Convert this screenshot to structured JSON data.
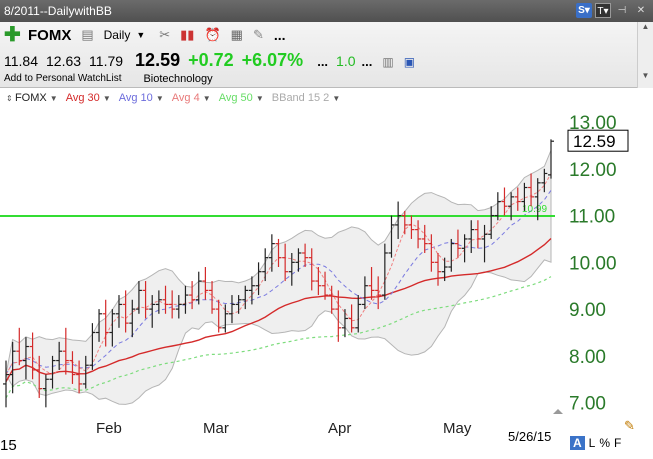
{
  "window": {
    "title": "8/2011--DailywithBB"
  },
  "toolbar": {
    "symbol": "FOMX",
    "period": "Daily",
    "more": "..."
  },
  "quote": {
    "open": "11.84",
    "high": "12.63",
    "low": "11.79",
    "last": "12.59",
    "change": "+0.72",
    "change_pct": "+6.07%",
    "ellipsis1": "...",
    "volume_ratio": "1.0",
    "ellipsis2": "...",
    "watchlist_link": "Add to Personal WatchList",
    "industry": "Biotechnology"
  },
  "studies": {
    "fomx": "FOMX",
    "avg30": "Avg 30",
    "avg10": "Avg 10",
    "avg4": "Avg 4",
    "avg50": "Avg 50",
    "bband": "BBand 15 2"
  },
  "axis": {
    "price_ticks": [
      "13.00",
      "12.00",
      "11.00",
      "10.00",
      "9.00",
      "8.00",
      "7.00"
    ],
    "months": [
      "Feb",
      "Mar",
      "Apr",
      "May"
    ],
    "current_price_box": "12.59",
    "line_label": "10.99",
    "bottom_left": "15",
    "date": "5/26/15"
  },
  "footer": {
    "a": "A",
    "l": "L",
    "pct": "%",
    "f": "F"
  },
  "colors": {
    "price_axis": "#2a7a2a",
    "change_green": "#22cc22",
    "up_bar": "#222222",
    "down_bar": "#d42a2a",
    "avg30": "#d42a2a",
    "avg10": "#7a7ae0",
    "avg4": "#f08080",
    "avg50": "#7ddc7d",
    "bband_fill": "#efefef",
    "hline": "#33dd33"
  },
  "icons": [
    "plus-icon",
    "stack-icon",
    "tools-icon",
    "bar-chart-icon",
    "alarm-icon",
    "grid-icon",
    "notes-icon",
    "database-icon",
    "save-icon"
  ],
  "chart_data": {
    "type": "line",
    "y_range": [
      6.8,
      13.3
    ],
    "hline": 10.99,
    "last": 12.59,
    "bars": [
      {
        "o": 7.4,
        "h": 7.9,
        "l": 6.9,
        "c": 7.6
      },
      {
        "o": 7.6,
        "h": 8.3,
        "l": 7.2,
        "c": 8.1
      },
      {
        "o": 8.1,
        "h": 8.6,
        "l": 7.8,
        "c": 7.9
      },
      {
        "o": 7.9,
        "h": 8.4,
        "l": 7.5,
        "c": 8.2
      },
      {
        "o": 8.2,
        "h": 8.5,
        "l": 7.5,
        "c": 7.7
      },
      {
        "o": 7.7,
        "h": 8.0,
        "l": 7.1,
        "c": 7.3
      },
      {
        "o": 7.3,
        "h": 7.6,
        "l": 6.9,
        "c": 7.5
      },
      {
        "o": 7.5,
        "h": 8.0,
        "l": 7.3,
        "c": 7.9
      },
      {
        "o": 7.9,
        "h": 8.3,
        "l": 7.7,
        "c": 8.1
      },
      {
        "o": 8.1,
        "h": 8.6,
        "l": 7.6,
        "c": 7.9
      },
      {
        "o": 7.9,
        "h": 8.1,
        "l": 7.4,
        "c": 7.6
      },
      {
        "o": 7.6,
        "h": 7.9,
        "l": 7.2,
        "c": 7.4
      },
      {
        "o": 7.4,
        "h": 8.0,
        "l": 7.3,
        "c": 7.8
      },
      {
        "o": 7.8,
        "h": 8.7,
        "l": 7.7,
        "c": 8.5
      },
      {
        "o": 8.5,
        "h": 9.0,
        "l": 8.3,
        "c": 8.9
      },
      {
        "o": 8.9,
        "h": 9.2,
        "l": 8.2,
        "c": 8.5
      },
      {
        "o": 8.5,
        "h": 9.0,
        "l": 8.2,
        "c": 8.9
      },
      {
        "o": 8.9,
        "h": 9.3,
        "l": 8.6,
        "c": 9.1
      },
      {
        "o": 9.1,
        "h": 9.4,
        "l": 8.5,
        "c": 8.7
      },
      {
        "o": 8.7,
        "h": 9.2,
        "l": 8.4,
        "c": 9.0
      },
      {
        "o": 9.0,
        "h": 9.6,
        "l": 8.9,
        "c": 9.4
      },
      {
        "o": 9.4,
        "h": 9.6,
        "l": 8.8,
        "c": 9.0
      },
      {
        "o": 9.0,
        "h": 9.3,
        "l": 8.6,
        "c": 9.1
      },
      {
        "o": 9.1,
        "h": 9.4,
        "l": 8.9,
        "c": 9.2
      },
      {
        "o": 9.2,
        "h": 9.5,
        "l": 8.9,
        "c": 9.1
      },
      {
        "o": 9.1,
        "h": 9.4,
        "l": 8.8,
        "c": 9.0
      },
      {
        "o": 9.0,
        "h": 9.3,
        "l": 8.8,
        "c": 9.1
      },
      {
        "o": 9.1,
        "h": 9.5,
        "l": 8.9,
        "c": 9.3
      },
      {
        "o": 9.3,
        "h": 9.6,
        "l": 9.0,
        "c": 9.2
      },
      {
        "o": 9.2,
        "h": 9.8,
        "l": 9.1,
        "c": 9.6
      },
      {
        "o": 9.6,
        "h": 9.9,
        "l": 9.2,
        "c": 9.4
      },
      {
        "o": 9.4,
        "h": 9.6,
        "l": 8.9,
        "c": 9.0
      },
      {
        "o": 9.0,
        "h": 9.2,
        "l": 8.5,
        "c": 8.6
      },
      {
        "o": 8.6,
        "h": 9.1,
        "l": 8.5,
        "c": 8.9
      },
      {
        "o": 8.9,
        "h": 9.3,
        "l": 8.7,
        "c": 9.1
      },
      {
        "o": 9.1,
        "h": 9.3,
        "l": 8.9,
        "c": 9.2
      },
      {
        "o": 9.2,
        "h": 9.5,
        "l": 9.0,
        "c": 9.4
      },
      {
        "o": 9.4,
        "h": 9.7,
        "l": 9.1,
        "c": 9.5
      },
      {
        "o": 9.5,
        "h": 10.0,
        "l": 9.3,
        "c": 9.8
      },
      {
        "o": 9.8,
        "h": 10.3,
        "l": 9.6,
        "c": 10.1
      },
      {
        "o": 10.1,
        "h": 10.6,
        "l": 9.8,
        "c": 10.4
      },
      {
        "o": 10.4,
        "h": 10.5,
        "l": 9.9,
        "c": 10.1
      },
      {
        "o": 10.1,
        "h": 10.4,
        "l": 9.6,
        "c": 9.8
      },
      {
        "o": 9.8,
        "h": 10.2,
        "l": 9.5,
        "c": 10.0
      },
      {
        "o": 10.0,
        "h": 10.3,
        "l": 9.8,
        "c": 10.2
      },
      {
        "o": 10.2,
        "h": 10.4,
        "l": 9.9,
        "c": 10.1
      },
      {
        "o": 10.1,
        "h": 10.3,
        "l": 9.4,
        "c": 9.6
      },
      {
        "o": 9.6,
        "h": 9.9,
        "l": 9.3,
        "c": 9.5
      },
      {
        "o": 9.5,
        "h": 9.8,
        "l": 9.2,
        "c": 9.3
      },
      {
        "o": 9.3,
        "h": 9.5,
        "l": 8.9,
        "c": 9.0
      },
      {
        "o": 9.0,
        "h": 9.4,
        "l": 8.3,
        "c": 8.6
      },
      {
        "o": 8.6,
        "h": 9.0,
        "l": 8.4,
        "c": 8.8
      },
      {
        "o": 8.8,
        "h": 9.1,
        "l": 8.5,
        "c": 8.6
      },
      {
        "o": 8.6,
        "h": 9.3,
        "l": 8.5,
        "c": 9.1
      },
      {
        "o": 9.1,
        "h": 9.7,
        "l": 9.0,
        "c": 9.5
      },
      {
        "o": 9.5,
        "h": 9.9,
        "l": 9.2,
        "c": 9.4
      },
      {
        "o": 9.4,
        "h": 9.7,
        "l": 9.0,
        "c": 9.3
      },
      {
        "o": 9.3,
        "h": 10.4,
        "l": 9.2,
        "c": 10.2
      },
      {
        "o": 10.2,
        "h": 11.0,
        "l": 10.1,
        "c": 10.8
      },
      {
        "o": 10.8,
        "h": 11.3,
        "l": 10.5,
        "c": 11.0
      },
      {
        "o": 11.0,
        "h": 11.1,
        "l": 10.6,
        "c": 10.8
      },
      {
        "o": 10.8,
        "h": 11.0,
        "l": 10.5,
        "c": 10.7
      },
      {
        "o": 10.7,
        "h": 10.9,
        "l": 10.3,
        "c": 10.5
      },
      {
        "o": 10.5,
        "h": 10.8,
        "l": 10.2,
        "c": 10.4
      },
      {
        "o": 10.4,
        "h": 10.6,
        "l": 9.8,
        "c": 10.0
      },
      {
        "o": 10.0,
        "h": 10.2,
        "l": 9.5,
        "c": 9.8
      },
      {
        "o": 9.8,
        "h": 10.1,
        "l": 9.6,
        "c": 9.9
      },
      {
        "o": 9.9,
        "h": 10.5,
        "l": 9.8,
        "c": 10.4
      },
      {
        "o": 10.4,
        "h": 10.7,
        "l": 10.1,
        "c": 10.3
      },
      {
        "o": 10.3,
        "h": 10.6,
        "l": 10.0,
        "c": 10.5
      },
      {
        "o": 10.5,
        "h": 10.9,
        "l": 10.2,
        "c": 10.7
      },
      {
        "o": 10.7,
        "h": 10.9,
        "l": 10.3,
        "c": 10.5
      },
      {
        "o": 10.5,
        "h": 10.8,
        "l": 10.0,
        "c": 10.6
      },
      {
        "o": 10.6,
        "h": 11.2,
        "l": 10.5,
        "c": 11.0
      },
      {
        "o": 11.0,
        "h": 11.5,
        "l": 10.9,
        "c": 11.3
      },
      {
        "o": 11.3,
        "h": 11.6,
        "l": 11.0,
        "c": 11.2
      },
      {
        "o": 11.2,
        "h": 11.5,
        "l": 10.9,
        "c": 11.4
      },
      {
        "o": 11.4,
        "h": 11.6,
        "l": 11.1,
        "c": 11.3
      },
      {
        "o": 11.3,
        "h": 11.7,
        "l": 11.1,
        "c": 11.6
      },
      {
        "o": 11.6,
        "h": 11.9,
        "l": 11.2,
        "c": 11.4
      },
      {
        "o": 11.4,
        "h": 11.8,
        "l": 10.9,
        "c": 11.7
      },
      {
        "o": 11.7,
        "h": 12.0,
        "l": 11.5,
        "c": 11.9
      },
      {
        "o": 11.87,
        "h": 12.63,
        "l": 11.79,
        "c": 12.59
      }
    ]
  }
}
